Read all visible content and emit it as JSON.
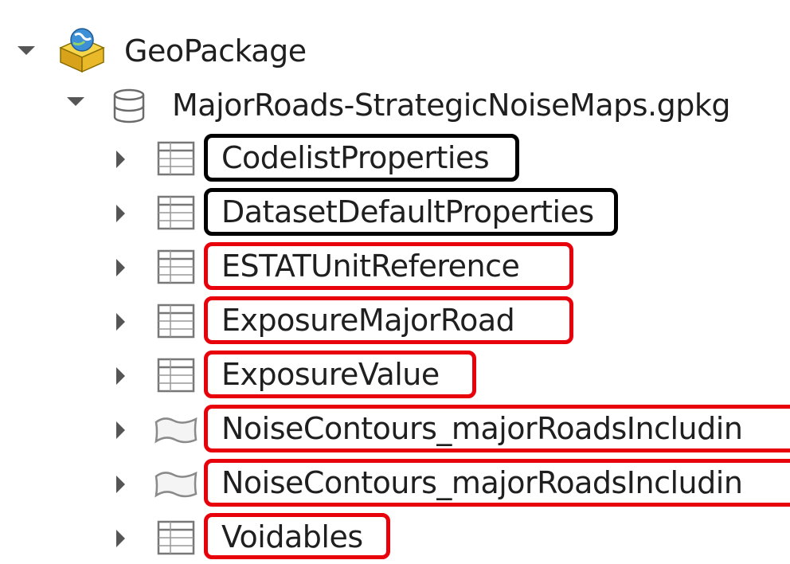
{
  "tree": {
    "root": {
      "label": "GeoPackage",
      "icon": "geopackage-icon"
    },
    "file": {
      "label": "MajorRoads-StrategicNoiseMaps.gpkg",
      "icon": "database-icon"
    },
    "items": [
      {
        "label": "CodelistProperties",
        "icon": "table-icon",
        "highlight": "#000000"
      },
      {
        "label": "DatasetDefaultProperties",
        "icon": "table-icon",
        "highlight": "#000000"
      },
      {
        "label": "ESTATUnitReference",
        "icon": "table-icon",
        "highlight": "#e8000b"
      },
      {
        "label": "ExposureMajorRoad",
        "icon": "table-icon",
        "highlight": "#e8000b"
      },
      {
        "label": "ExposureValue",
        "icon": "table-icon",
        "highlight": "#e8000b"
      },
      {
        "label": "NoiseContours_majorRoadsIncludin",
        "icon": "polygon-icon",
        "highlight": "#e8000b"
      },
      {
        "label": "NoiseContours_majorRoadsIncludin",
        "icon": "polygon-icon",
        "highlight": "#e8000b"
      },
      {
        "label": "Voidables",
        "icon": "table-icon",
        "highlight": "#e8000b"
      }
    ]
  }
}
